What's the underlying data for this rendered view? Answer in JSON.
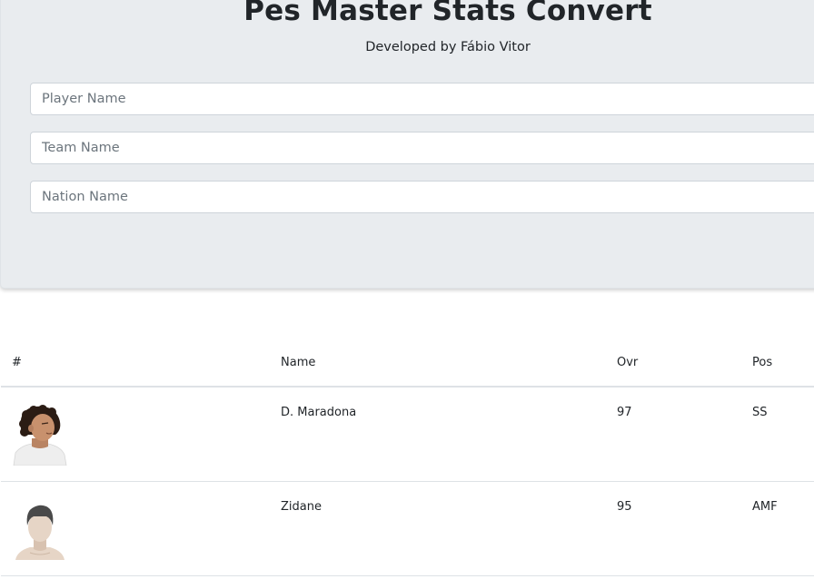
{
  "header": {
    "title": "Pes Master Stats Convert",
    "subtitle": "Developed by Fábio Vitor"
  },
  "search": {
    "player_placeholder": "Player Name",
    "team_placeholder": "Team Name",
    "nation_placeholder": "Nation Name"
  },
  "table": {
    "columns": [
      "#",
      "Name",
      "Ovr",
      "Pos"
    ],
    "rows": [
      {
        "photo": "player-photo",
        "name": "D. Maradona",
        "ovr": "97",
        "pos": "SS"
      },
      {
        "photo": "default-avatar",
        "name": "Zidane",
        "ovr": "95",
        "pos": "AMF"
      }
    ]
  },
  "colors": {
    "hero_background": "#e9ecef",
    "border": "#dee2e6",
    "text": "#212529"
  }
}
